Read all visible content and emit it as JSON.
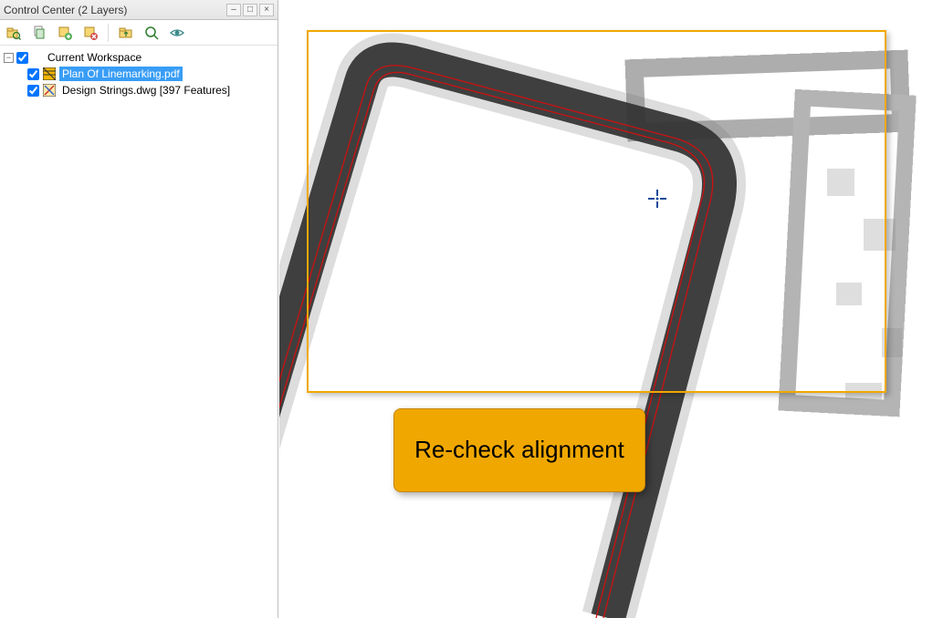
{
  "panel": {
    "title": "Control Center (2 Layers)",
    "toolbar_icons": [
      "open-folder-search-icon",
      "copy-icon",
      "new-layer-icon",
      "delete-layer-icon",
      "folder-up-icon",
      "zoom-icon",
      "visibility-icon"
    ]
  },
  "tree": {
    "root": {
      "label": "Current Workspace",
      "expanded": true,
      "checked": true
    },
    "items": [
      {
        "label": "Plan Of Linemarking.pdf",
        "checked": true,
        "selected": true,
        "icon": "layer-hatch-icon"
      },
      {
        "label": "Design Strings.dwg [397 Features]",
        "checked": true,
        "selected": false,
        "icon": "layer-cad-icon"
      }
    ]
  },
  "callout": {
    "text": "Re-check alignment"
  }
}
